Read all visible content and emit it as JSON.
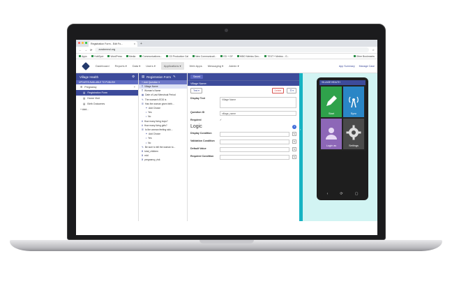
{
  "browser": {
    "tab_title": "Registration Form - Edit Fo...",
    "tab_close": "×",
    "new_tab": "+",
    "url": "zowbmmd.org",
    "bookmarks": [
      "Apps",
      "YubiSpot",
      "WordPress",
      "Media",
      "Communications...",
      "G3 Production Cal",
      "New Communicati...",
      "ED + GF",
      "HIBO Metrics Dev...",
      "TEXT+ Metrics - G...",
      "Other Bookmarks"
    ]
  },
  "app_nav": {
    "items": [
      "Dashboard",
      "Reports ▾",
      "Data ▾",
      "Users ▾",
      "Applications ▾",
      "Web Apps",
      "Messaging ▾",
      "Admin ▾"
    ]
  },
  "left_panel": {
    "title": "Village Health",
    "notice": "UPDATES AVAILABLE TO PUBLISH",
    "module": "Pregnancy",
    "module_add": "+",
    "forms": [
      "Registration Form",
      "Home Visit",
      "Birth Outcomes"
    ],
    "add_label": "+ Add..."
  },
  "form_panel": {
    "title": "Registration Form",
    "add_question": "+ Add Question ▾",
    "questions": [
      {
        "icon": "T",
        "label": "Village Name",
        "indent": false
      },
      {
        "icon": "T",
        "label": "Woman's Name",
        "indent": false
      },
      {
        "icon": "▦",
        "label": "Date of Last Menstrual Period",
        "indent": false
      },
      {
        "icon": "✎",
        "label": "The woman's EDD is",
        "indent": false
      },
      {
        "icon": "☰",
        "label": "Has the woman given birth...",
        "indent": false
      },
      {
        "icon": "+",
        "label": "Add Choice",
        "indent": true
      },
      {
        "icon": "•",
        "label": "Yes",
        "indent": true
      },
      {
        "icon": "•",
        "label": "No",
        "indent": true
      },
      {
        "icon": "#",
        "label": "How many living boys?",
        "indent": false
      },
      {
        "icon": "#",
        "label": "How many living girls?",
        "indent": false
      },
      {
        "icon": "☰",
        "label": "Is the woman feeling sick...",
        "indent": false
      },
      {
        "icon": "+",
        "label": "Add Choice",
        "indent": true
      },
      {
        "icon": "•",
        "label": "Yes",
        "indent": true
      },
      {
        "icon": "•",
        "label": "No",
        "indent": true
      },
      {
        "icon": "✎",
        "label": "Be sure to tell the woman to...",
        "indent": false
      },
      {
        "icon": "X",
        "label": "total_children",
        "indent": false
      },
      {
        "icon": "X",
        "label": "edd",
        "indent": false
      },
      {
        "icon": "X",
        "label": "pregnancy_risk",
        "indent": false
      }
    ]
  },
  "editor": {
    "save_label": "Saved",
    "question_header": "Village Name:",
    "type_label": "Text ▾",
    "delete_label": "Delete",
    "more_label": "☰ ▾",
    "display_text_label": "Display Text",
    "display_text_value": "Village Name",
    "question_id_label": "Question ID",
    "question_id_value": "village_name",
    "required_label": "Required",
    "required_mark": "✓",
    "logic_title": "Logic",
    "help_label": "?",
    "logic_rows": [
      "Display Condition",
      "Validation Condition",
      "Default Value",
      "Required Condition"
    ],
    "edit_glyph": "✎"
  },
  "top_right": {
    "app_summary": "App Summary",
    "manage_case": "Manage Case"
  },
  "phone": {
    "header": "VILLAGE HEALTH",
    "tiles": [
      "Start",
      "Sync",
      "Login as",
      "Settings"
    ],
    "nav": [
      "‹",
      "⟳",
      "▢"
    ]
  },
  "colors": {
    "brand": "#3d4b9b",
    "accent": "#16b3c3",
    "start_tile": "#2fa24b",
    "sync_tile": "#2a86c6",
    "login_tile": "#8d67b7"
  }
}
